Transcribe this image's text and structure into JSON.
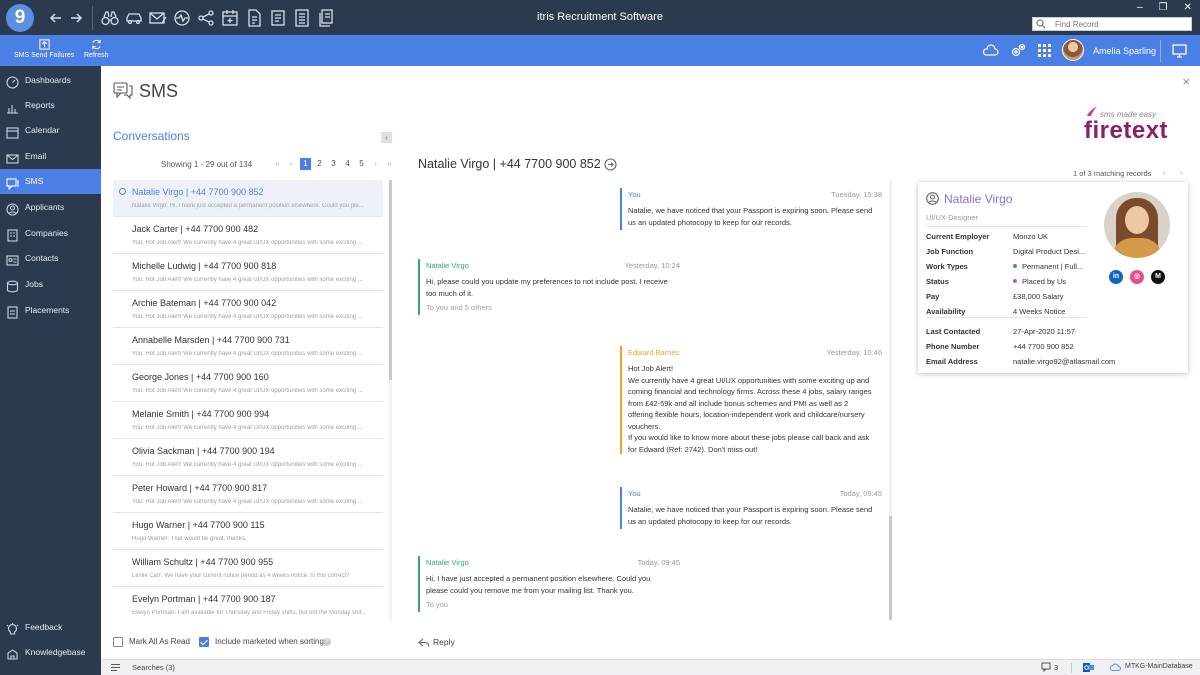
{
  "app": {
    "logo_text": "9",
    "title": "itris Recruitment Software",
    "find_placeholder": "Find Record",
    "window_controls": [
      "–",
      "❐",
      "✕"
    ]
  },
  "toolbar": {
    "sms_send_failures": "SMS Send Failures",
    "refresh": "Refresh",
    "user_name": "Amelia Sparling"
  },
  "sidebar": {
    "items": [
      {
        "label": "Dashboards",
        "icon": "dashboard-icon"
      },
      {
        "label": "Reports",
        "icon": "reports-icon"
      },
      {
        "label": "Calendar",
        "icon": "calendar-icon"
      },
      {
        "label": "Email",
        "icon": "email-icon"
      },
      {
        "label": "SMS",
        "icon": "sms-icon",
        "active": true
      },
      {
        "label": "Applicants",
        "icon": "applicants-icon"
      },
      {
        "label": "Companies",
        "icon": "companies-icon"
      },
      {
        "label": "Contacts",
        "icon": "contacts-icon"
      },
      {
        "label": "Jobs",
        "icon": "jobs-icon"
      },
      {
        "label": "Placements",
        "icon": "placements-icon"
      }
    ],
    "bottom_items": [
      {
        "label": "Feedback",
        "icon": "lightbulb-icon"
      },
      {
        "label": "Knowledgebase",
        "icon": "knowledgebase-icon"
      }
    ]
  },
  "page": {
    "title": "SMS",
    "close": "×"
  },
  "brand": {
    "tagline": "sms made easy",
    "wordmark": "firetext",
    "color": "#8b1e6e"
  },
  "conversations": {
    "title": "Conversations",
    "collapse": "‹",
    "showing": "Showing 1 - 29 out of 134",
    "pager": {
      "first": "«",
      "prev": "‹",
      "pages": [
        "1",
        "2",
        "3",
        "4",
        "5"
      ],
      "current": "1",
      "next": "›",
      "last": "»"
    },
    "items": [
      {
        "name": "Natalie Virgo | +44 7700 900 852",
        "snippet": "Natalie Virgo: Hi, I have just accepted a permanent position elsewhere. Could you ple...",
        "active": true
      },
      {
        "name": "Jack Carter | +44 7700 900 482",
        "snippet": "You: Hot Job Alert! We currently have 4 great UI/UX opportunities with some exciting ..."
      },
      {
        "name": "Michelle Ludwig | +44 7700 900 818",
        "snippet": "You: Hot Job Alert! We currently have 4 great UI/UX opportunities with some exciting ..."
      },
      {
        "name": "Archie Bateman | +44 7700 900 042",
        "snippet": "You: Hot Job Alert! We currently have 4 great UI/UX opportunities with some exciting ..."
      },
      {
        "name": "Annabelle Marsden | +44 7700 900 731",
        "snippet": "You: Hot Job Alert! We currently have 4 great UI/UX opportunities with some exciting ..."
      },
      {
        "name": "George Jones | +44 7700 900 160",
        "snippet": "You: Hot Job Alert! We currently have 4 great UI/UX opportunities with some exciting ..."
      },
      {
        "name": "Melanie Smith | +44 7700 900 994",
        "snippet": "You: Hot Job Alert! We currently have 4 great UI/UX opportunities with some exciting ..."
      },
      {
        "name": "Olivia Sackman | +44 7700 900 194",
        "snippet": "You: Hot Job Alert! We currently have 4 great UI/UX opportunities with some exciting ..."
      },
      {
        "name": "Peter Howard | +44 7700 900 817",
        "snippet": "You: Hot Job Alert! We currently have 4 great UI/UX opportunities with some exciting ..."
      },
      {
        "name": "Hugo Warner | +44 7700 900 115",
        "snippet": "Hugo Warner: That would be great, thanks."
      },
      {
        "name": "William Schultz | +44 7700 900 955",
        "snippet": "Leslie Carr: We have your current notice period as 4 weeks notice. Is this correct?"
      },
      {
        "name": "Evelyn Portman | +44 7700 900 187",
        "snippet": "Evelyn Portman: I am available for Thursday and Friday shifts, but not the Monday shif..."
      }
    ],
    "mark_all_read": "Mark All As Read",
    "include_marketed": "Include marketed when sorting",
    "help": "?"
  },
  "thread": {
    "title": "Natalie Virgo | +44 7700 900 852",
    "messages": [
      {
        "sender": "You",
        "time": "Tuesday, 15:38",
        "body": "Natalie, we have noticed that your Passport is expiring soon. Please send\nus an updated photocopy to keep for our records.",
        "recipients": ""
      },
      {
        "sender": "Natalie Virgo",
        "time": "Yesterday, 10:24",
        "body": "Hi, please could you update my preferences to not include post. I receive\ntoo much of it.",
        "recipients": "To you and 5 others"
      },
      {
        "sender": "Edward Barnes",
        "time": "Yesterday, 10:46",
        "body": "Hot Job Alert!\nWe currently have 4 great UI/UX opportunities with some exciting up and\ncoming financial and technology firms. Across these 4 jobs, salary ranges\nfrom £42-59k and all include bonus schemes and PMI as well as 2\noffering flexible hours, location-independent work and childcare/nursery\nvouchers.\nIf you would like to know more about these jobs please call back and ask\nfor Edward (Ref: 2742). Don't miss out!",
        "recipients": ""
      },
      {
        "sender": "You",
        "time": "Today, 09:45",
        "body": "Natalie, we have noticed that your Passport is expiring soon. Please send\nus an updated photocopy to keep for our records.",
        "recipients": ""
      },
      {
        "sender": "Natalie Virgo",
        "time": "Today, 09:45",
        "body": "Hi, I have just accepted a permanent position elsewhere. Could you\nplease could you remove me from your mailing list. Thank you.",
        "recipients": "To you"
      }
    ],
    "reply": "Reply"
  },
  "contact": {
    "matching": "1 of 3 matching records",
    "match_nav": "‹ ›",
    "name": "Natalie Virgo",
    "role": "UI/UX Designer",
    "social": [
      {
        "label": "in",
        "icon": "linkedin-icon",
        "color": "#0a66c2"
      },
      {
        "label": "◎",
        "icon": "dribbble-icon",
        "color": "#ea4c89"
      },
      {
        "label": "M",
        "icon": "medium-icon",
        "color": "#111111"
      }
    ],
    "fields": [
      {
        "key": "Current Employer",
        "value": "Monzo UK"
      },
      {
        "key": "Job Function",
        "value": "Digital Product Desi..."
      },
      {
        "key": "Work Types",
        "value": "Permanent | Full..."
      },
      {
        "key": "Status",
        "value": "Placed by Us"
      },
      {
        "key": "Pay",
        "value": "£38,000 Salary"
      },
      {
        "key": "Availability",
        "value": "4 Weeks Notice"
      }
    ],
    "fields2": [
      {
        "key": "Last Contacted",
        "value": "27-Apr-2020   11:57"
      },
      {
        "key": "Phone Number",
        "value": "+44 7700 900 852"
      },
      {
        "key": "Email Address",
        "value": "natalie.virgo92@atlasmail.com"
      }
    ]
  },
  "statusbar": {
    "searches": "Searches (3)",
    "sms_count": "3",
    "database": "MTKG-MainDatabase"
  }
}
